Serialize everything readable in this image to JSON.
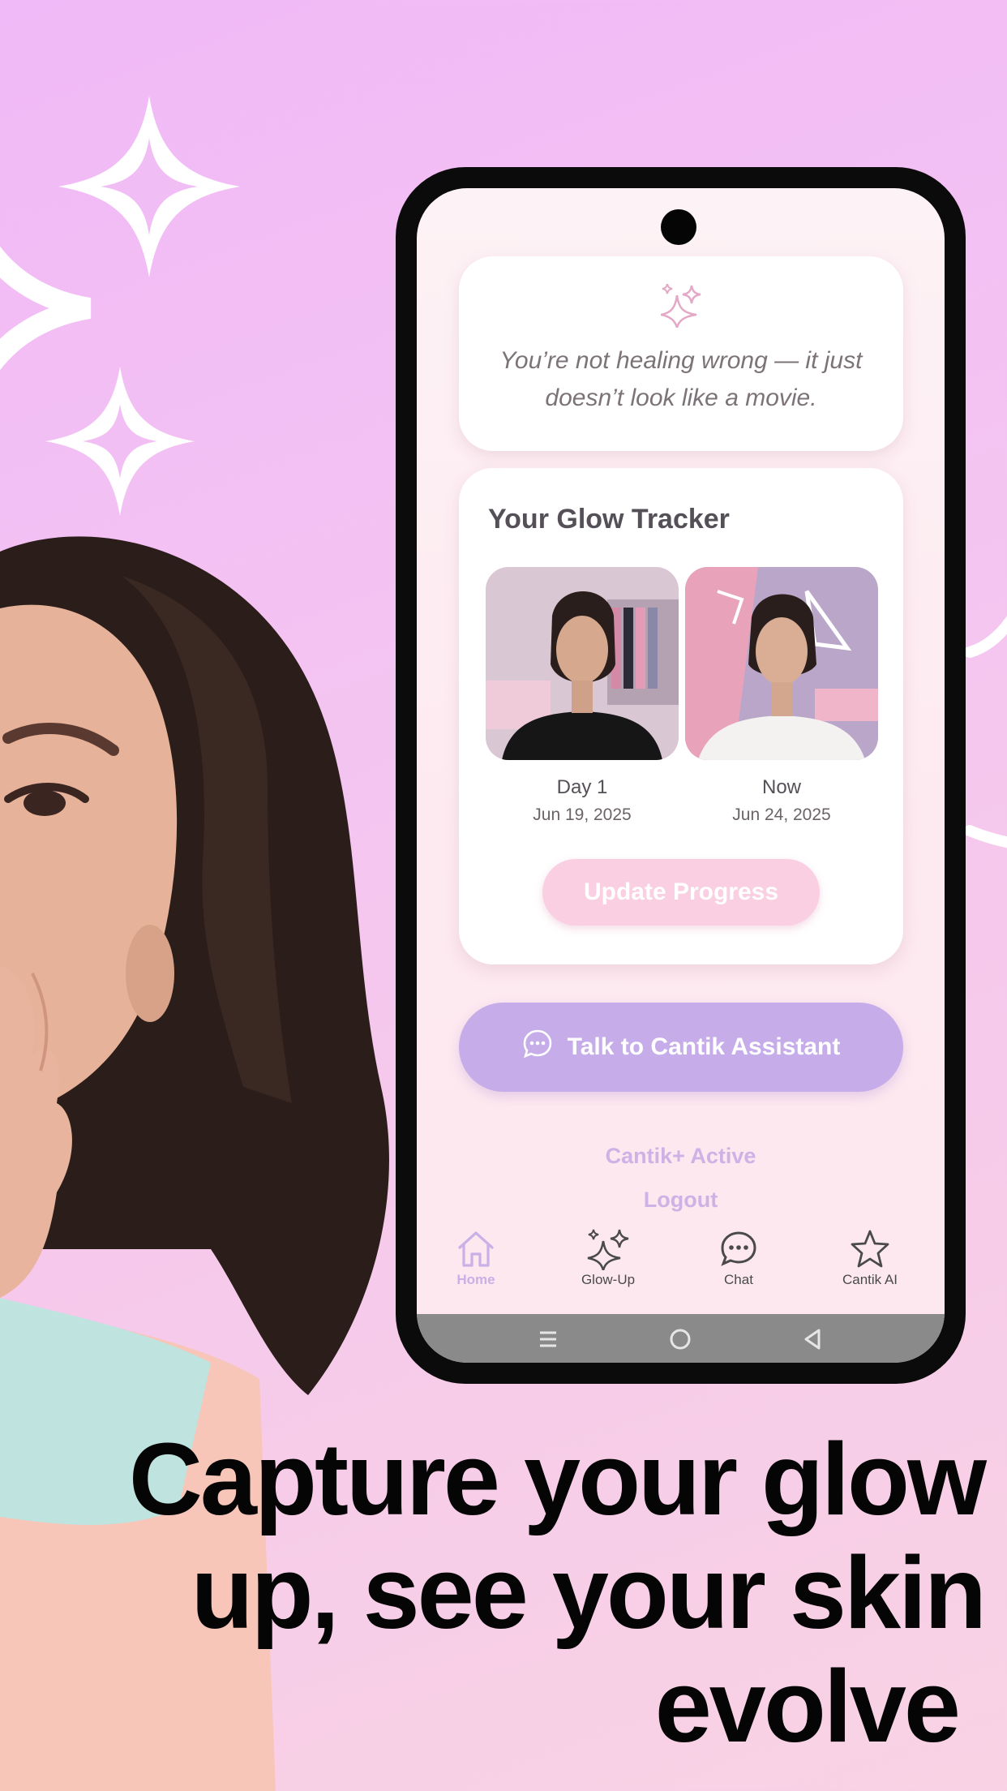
{
  "colors": {
    "background": "#f4c3f2",
    "accent_purple": "#c6ade9",
    "accent_pink": "#f9cfe1",
    "headline": "#050505"
  },
  "quote": {
    "icon": "sparkles-icon",
    "text": "You’re not healing wrong — it just doesn’t look like a movie."
  },
  "tracker": {
    "title": "Your Glow Tracker",
    "photos": [
      {
        "label": "Day 1",
        "date": "Jun 19, 2025"
      },
      {
        "label": "Now",
        "date": "Jun 24, 2025"
      }
    ],
    "update_button": "Update Progress"
  },
  "assistant_button": {
    "icon": "chat-bubble-icon",
    "label": "Talk to Cantik Assistant"
  },
  "links": {
    "subscription": "Cantik+ Active",
    "logout": "Logout"
  },
  "bottom_nav": [
    {
      "icon": "home-icon",
      "label": "Home",
      "active": true
    },
    {
      "icon": "sparkles-icon",
      "label": "Glow-Up",
      "active": false
    },
    {
      "icon": "chat-icon",
      "label": "Chat",
      "active": false
    },
    {
      "icon": "star-icon",
      "label": "Cantik AI",
      "active": false
    }
  ],
  "system_nav": [
    "recents-icon",
    "home-circle-icon",
    "back-icon"
  ],
  "headline": {
    "line1": "Capture your glow",
    "line2": "up, see your skin",
    "line3": "evolve"
  }
}
